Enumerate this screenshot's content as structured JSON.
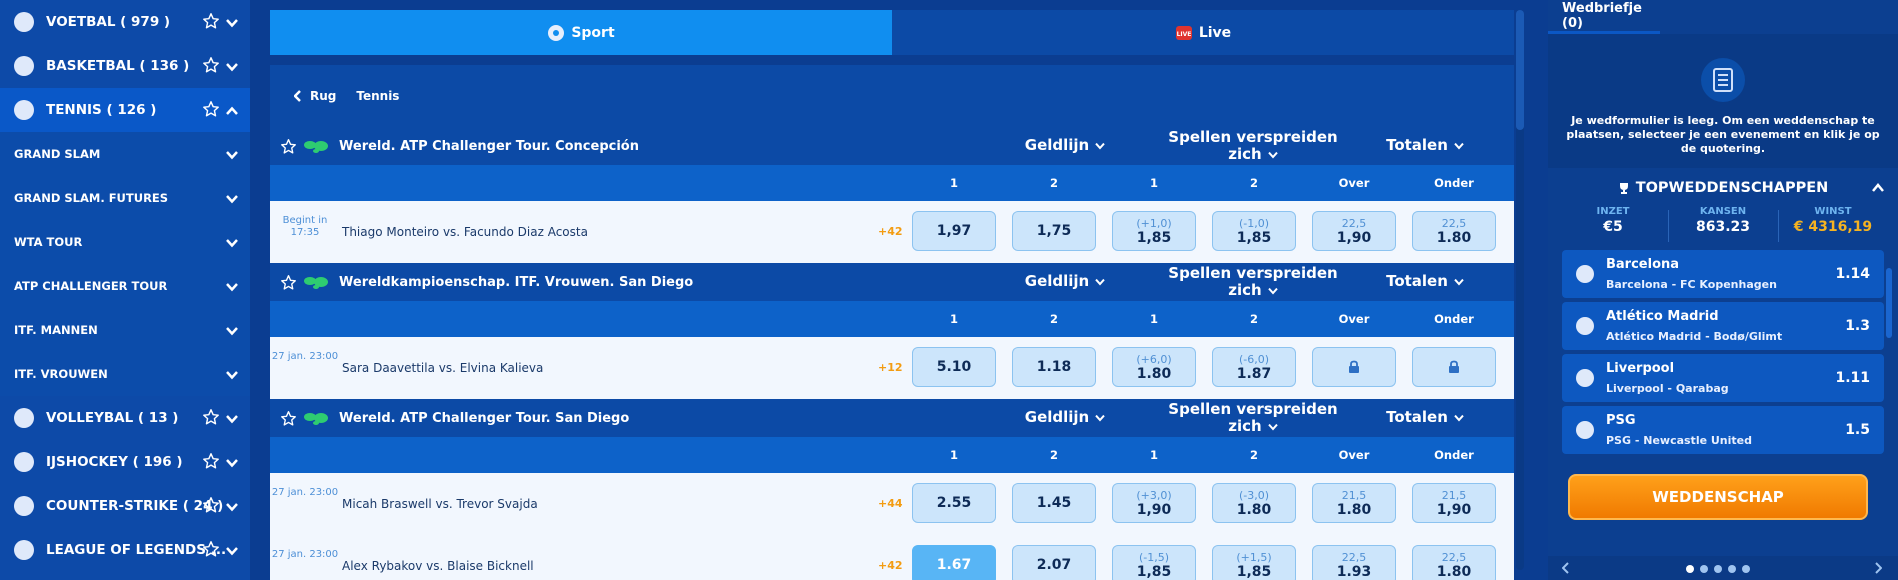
{
  "sidebar": {
    "sports": [
      {
        "label": "VOETBAL ( 979 )",
        "icon": "football-icon"
      },
      {
        "label": "BASKETBAL ( 136 )",
        "icon": "basketball-icon"
      },
      {
        "label": "TENNIS ( 126 )",
        "icon": "tennis-icon",
        "expanded": true
      }
    ],
    "tennis_subs": [
      "GRAND SLAM",
      "GRAND SLAM. FUTURES",
      "WTA TOUR",
      "ATP CHALLENGER TOUR",
      "ITF. MANNEN",
      "ITF. VROUWEN"
    ],
    "more_sports": [
      {
        "label": "VOLLEYBAL ( 13 )",
        "icon": "volleyball-icon"
      },
      {
        "label": "IJSHOCKEY ( 196 )",
        "icon": "hockey-icon"
      },
      {
        "label": "COUNTER-STRIKE ( 24 )",
        "icon": "counter-strike-icon"
      },
      {
        "label": "LEAGUE OF LEGENDS ...",
        "icon": "lol-icon"
      }
    ]
  },
  "tabs": {
    "sport": "Sport",
    "live": "Live"
  },
  "breadcrumb": {
    "back": "Rug",
    "current": "Tennis"
  },
  "markets": {
    "moneyline": "Geldlijn",
    "spread": "Spellen verspreiden zich",
    "totals": "Totalen"
  },
  "columns": [
    "1",
    "2",
    "1",
    "2",
    "Over",
    "Onder"
  ],
  "leagues": [
    {
      "name": "Wereld. ATP Challenger Tour. Concepción",
      "matches": [
        {
          "time": "Begint in 17:35",
          "teams": "Thiago Monteiro  vs.  Facundo Diaz Acosta",
          "more": "+42",
          "odds": [
            {
              "v": "1,97"
            },
            {
              "v": "1,75"
            },
            {
              "h": "(+1,0)",
              "v": "1,85"
            },
            {
              "h": "(-1,0)",
              "v": "1,85"
            },
            {
              "h": "22,5",
              "v": "1,90"
            },
            {
              "h": "22,5",
              "v": "1.80"
            }
          ]
        }
      ]
    },
    {
      "name": "Wereldkampioenschap. ITF. Vrouwen. San Diego",
      "matches": [
        {
          "time": "27 jan. 23:00",
          "teams": "Sara Daavettila  vs.  Elvina Kalieva",
          "more": "+12",
          "odds": [
            {
              "v": "5.10"
            },
            {
              "v": "1.18"
            },
            {
              "h": "(+6,0)",
              "v": "1.80"
            },
            {
              "h": "(-6,0)",
              "v": "1.87"
            },
            {
              "lock": true
            },
            {
              "lock": true
            }
          ]
        }
      ]
    },
    {
      "name": "Wereld. ATP Challenger Tour. San Diego",
      "matches": [
        {
          "time": "27 jan. 23:00",
          "teams": "Micah Braswell  vs.  Trevor Svajda",
          "more": "+44",
          "odds": [
            {
              "v": "2.55"
            },
            {
              "v": "1.45"
            },
            {
              "h": "(+3,0)",
              "v": "1,90"
            },
            {
              "h": "(-3,0)",
              "v": "1.80"
            },
            {
              "h": "21,5",
              "v": "1.80"
            },
            {
              "h": "21,5",
              "v": "1,90"
            }
          ]
        },
        {
          "time": "27 jan. 23:00",
          "teams": "Alex Rybakov  vs.  Blaise Bicknell",
          "more": "+42",
          "odds": [
            {
              "v": "1.67",
              "sel": true
            },
            {
              "v": "2.07"
            },
            {
              "h": "(-1,5)",
              "v": "1,85"
            },
            {
              "h": "(+1,5)",
              "v": "1,85"
            },
            {
              "h": "22,5",
              "v": "1.93"
            },
            {
              "h": "22,5",
              "v": "1.80"
            }
          ]
        }
      ]
    }
  ],
  "betslip": {
    "title": "Wedbriefje (0)",
    "empty_text": "Je wedformulier is leeg. Om een weddenschap te plaatsen, selecteer je een evenement en klik je op de quotering.",
    "top_title": "TOPWEDDENSCHAPPEN",
    "stats": {
      "stake_label": "INZET",
      "stake": "€5",
      "odds_label": "KANSEN",
      "odds": "863.23",
      "win_label": "WINST",
      "win": "€ 4316,19"
    },
    "picks": [
      {
        "team": "Barcelona",
        "match": "Barcelona - FC Kopenhagen",
        "odd": "1.14"
      },
      {
        "team": "Atlético Madrid",
        "match": "Atlético Madrid - Bodø/Glimt",
        "odd": "1.3"
      },
      {
        "team": "Liverpool",
        "match": "Liverpool - Qarabag",
        "odd": "1.11"
      },
      {
        "team": "PSG",
        "match": "PSG - Newcastle United",
        "odd": "1.5"
      }
    ],
    "button": "WEDDENSCHAP"
  }
}
